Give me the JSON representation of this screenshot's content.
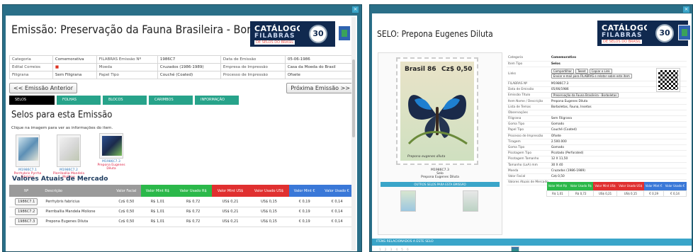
{
  "left": {
    "title": "Emissão: Preservação da Fauna Brasileira - Borboletas",
    "logo": {
      "line1": "CATÁLOGO",
      "line2": "FILABRAS",
      "line3": "DE SELOS DO BRASIL",
      "seal": "30"
    },
    "info_rows": [
      [
        "Categoria",
        "Comemorativa",
        "FILABRAS Emissão Nº",
        "1986C7",
        "Data de Emissão",
        "05-06-1986"
      ],
      [
        "Edital Correios",
        "",
        "Moeda",
        "Cruzados (1986-1989)",
        "Empresa de Impressão",
        "Casa da Moeda do Brasil"
      ],
      [
        "Filigrana",
        "Sem Filigrana",
        "Papel Tipo",
        "Couché (Coated)",
        "Processo de Impressão",
        "Ofsete"
      ]
    ],
    "prev_button": "<< Emissão Anterior",
    "next_button": "Próxima Emissão >>",
    "tabs": [
      "SELOS",
      "FOLHAS",
      "BLOCOS",
      "CARIMBOS",
      "INFORMAÇÃO"
    ],
    "section_title": "Selos para esta Emissão",
    "instruction": "Clique na imagem para ver as informações do item.",
    "thumbs": [
      {
        "code": "M1986C7.1",
        "name": "Perrhybris Pyrrha fabricius"
      },
      {
        "code": "M1986C7.2",
        "name": "Pierriballia Mandela Molione"
      },
      {
        "code": "M1986C7.3",
        "name": "Prepona Eugenes Diluta"
      }
    ],
    "market_title": "Valores Atuais de Mercado",
    "market_headers": [
      "Nº",
      "Descrição",
      "Valor Facial",
      "Valor Mint R$",
      "Valor Usado R$",
      "Valor Mint US$",
      "Valor Usado US$",
      "Valor Mint €",
      "Valor Usado €"
    ],
    "market_rows": [
      [
        "1986C7.1",
        "Perrhybris fabricius",
        "Cz$ 0,50",
        "R$ 1,01",
        "R$ 0,72",
        "US$ 0,21",
        "US$ 0,15",
        "€ 0,19",
        "€ 0,14"
      ],
      [
        "1986C7.2",
        "Pierriballia Mandela Molione",
        "Cz$ 0,50",
        "R$ 1,01",
        "R$ 0,72",
        "US$ 0,21",
        "US$ 0,15",
        "€ 0,19",
        "€ 0,14"
      ],
      [
        "1986C7.3",
        "Prepona Eugenes Diluta",
        "Cz$ 0,50",
        "R$ 1,01",
        "R$ 0,72",
        "US$ 0,21",
        "US$ 0,15",
        "€ 0,19",
        "€ 0,14"
      ]
    ],
    "market_colors": [
      "#9a9a9a",
      "#9a9a9a",
      "#9a9a9a",
      "#2bb84a",
      "#2bb84a",
      "#e03030",
      "#e03030",
      "#3a78d8",
      "#3a78d8"
    ]
  },
  "right": {
    "title": "SELO: Prepona Eugenes Diluta",
    "logo": {
      "line1": "CATÁLOGO",
      "line2": "FILABRAS",
      "line3": "DE SELOS DO BRASIL",
      "seal": "30"
    },
    "stamp": {
      "country": "Brasil 86",
      "value": "Cz$ 0,50",
      "caption": "Prepona eugenes diluta"
    },
    "stamp_code": "M1986C7.3",
    "stamp_kind": "Selo",
    "stamp_name": "Prepona Eugenes Diluta",
    "other_stamps_label": "OUTROS SELOS PARA ESTA EMISSÃO",
    "details": [
      [
        "Categoria",
        "Comemorativo"
      ],
      [
        "Item Tipo",
        "Selos"
      ],
      [
        "Links",
        ""
      ],
      [
        "FILABRAS Nº",
        "M1986C7.3"
      ],
      [
        "Data de Emissão",
        "05/06/1986"
      ],
      [
        "Emissão Título",
        "Preservação da Fauna Brasileira - Borboletas"
      ],
      [
        "Item Nome / Descrição",
        "Prepona Eugenes Diluta"
      ],
      [
        "Lista de Temas",
        "Borboletas, Fauna, Insetos"
      ],
      [
        "Observações",
        ""
      ],
      [
        "Filigrana",
        "Sem Filigrana"
      ],
      [
        "Goma Tipo",
        "Gomado"
      ],
      [
        "Papel Tipo",
        "Couché (Coated)"
      ],
      [
        "Processo de Impressão",
        "Ofsete"
      ],
      [
        "Tiragem",
        "2.500.000"
      ],
      [
        "Goma Tipo",
        "Gomado"
      ],
      [
        "Picotagem Tipo",
        "Picotado (Perforated)"
      ],
      [
        "Picotagem Tamanho",
        "12 X 11,50"
      ],
      [
        "Tamanho (LxA) mm",
        "30 X 40"
      ],
      [
        "Moeda",
        "Cruzados (1986-1989)"
      ],
      [
        "Valor Facial",
        "Cz$ 0,50"
      ],
      [
        "Valores Atuais de Mercado",
        ""
      ]
    ],
    "share_buttons": [
      "Compartilhar",
      "Tweet",
      "Copiar o Link"
    ],
    "report_button": "Enviar e-mail para FILABRAS e relatar sobre este item",
    "value_headers": [
      "Valor Mint R$",
      "Valor Usado R$",
      "Valor Mint US$",
      "Valor Usado US$",
      "Valor Mint €",
      "Valor Usado €"
    ],
    "value_row": [
      "R$ 1,01",
      "R$ 0,72",
      "US$ 0,21",
      "US$ 0,15",
      "€ 0,19",
      "€ 0,14"
    ],
    "value_colors": [
      "#2bb84a",
      "#2bb84a",
      "#e03030",
      "#e03030",
      "#3a78d8",
      "#3a78d8"
    ],
    "related_bar": "ITENS RELACIONADOS A ESTE SELO",
    "footer_text": "1  2  3  4  5  6"
  }
}
